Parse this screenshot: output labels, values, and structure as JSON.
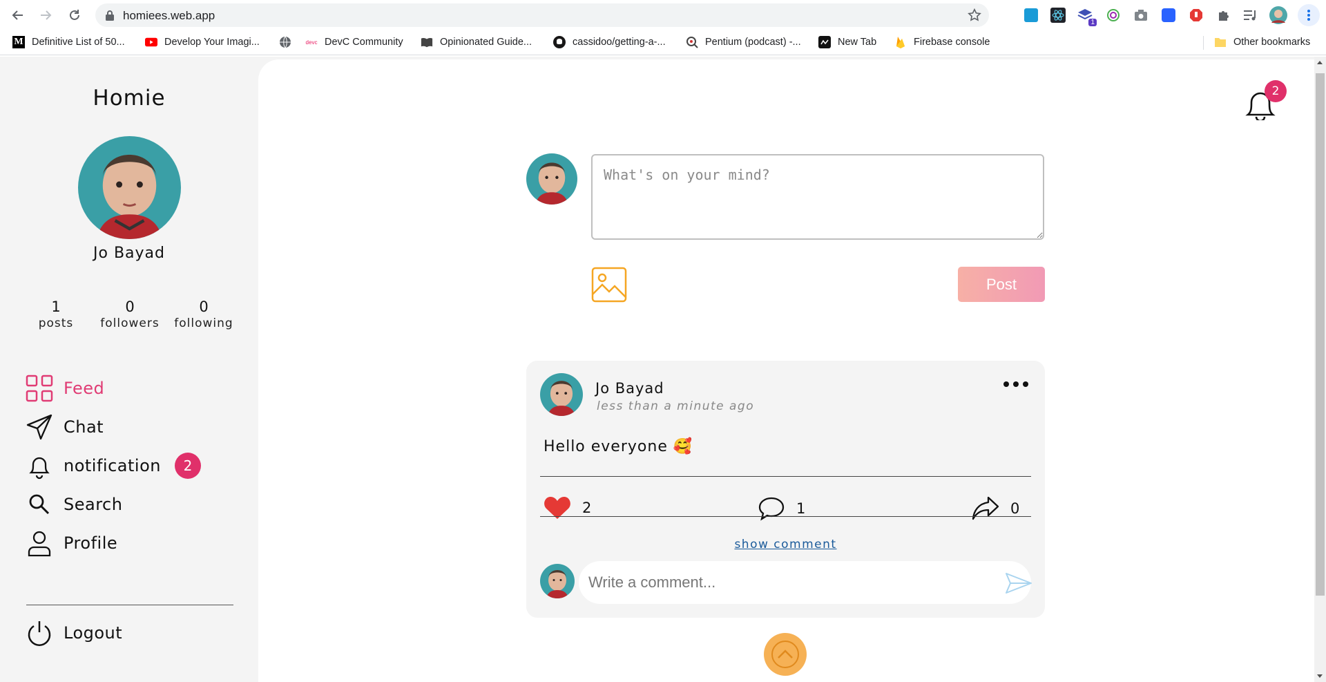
{
  "browser": {
    "url": "homiees.web.app",
    "extension_badge": "1",
    "bookmarks": [
      {
        "label": "Definitive List of 50..."
      },
      {
        "label": "Develop Your Imagi..."
      },
      {
        "label": ""
      },
      {
        "label": "DevC Community"
      },
      {
        "label": "Opinionated Guide..."
      },
      {
        "label": "cassidoo/getting-a-..."
      },
      {
        "label": "Pentium (podcast) -..."
      },
      {
        "label": "New Tab"
      },
      {
        "label": "Firebase console"
      }
    ],
    "other_bookmarks": "Other bookmarks"
  },
  "sidebar": {
    "brand": "Homie",
    "user_name": "Jo Bayad",
    "stats": [
      {
        "value": "1",
        "label": "posts"
      },
      {
        "value": "0",
        "label": "followers"
      },
      {
        "value": "0",
        "label": "following"
      }
    ],
    "menu": [
      {
        "label": "Feed",
        "icon": "grid-icon",
        "active": true
      },
      {
        "label": "Chat",
        "icon": "send-icon"
      },
      {
        "label": "notification",
        "icon": "bell-icon",
        "badge": "2"
      },
      {
        "label": "Search",
        "icon": "search-icon"
      },
      {
        "label": "Profile",
        "icon": "user-icon"
      }
    ],
    "logout": "Logout"
  },
  "header": {
    "notification_count": "2"
  },
  "composer": {
    "placeholder": "What's on your mind?",
    "post_label": "Post"
  },
  "post": {
    "author": "Jo Bayad",
    "time": "less than a minute ago",
    "text": "Hello everyone 🥰",
    "likes": "2",
    "comments": "1",
    "shares": "0",
    "show_comment": "show comment",
    "comment_placeholder": "Write a comment..."
  },
  "colors": {
    "accent": "#e03b74",
    "badge": "#e0306a",
    "post_gradient": [
      "#f7b0a6",
      "#f19ab5"
    ],
    "image_icon": "#f5a623",
    "like": "#e53935"
  }
}
